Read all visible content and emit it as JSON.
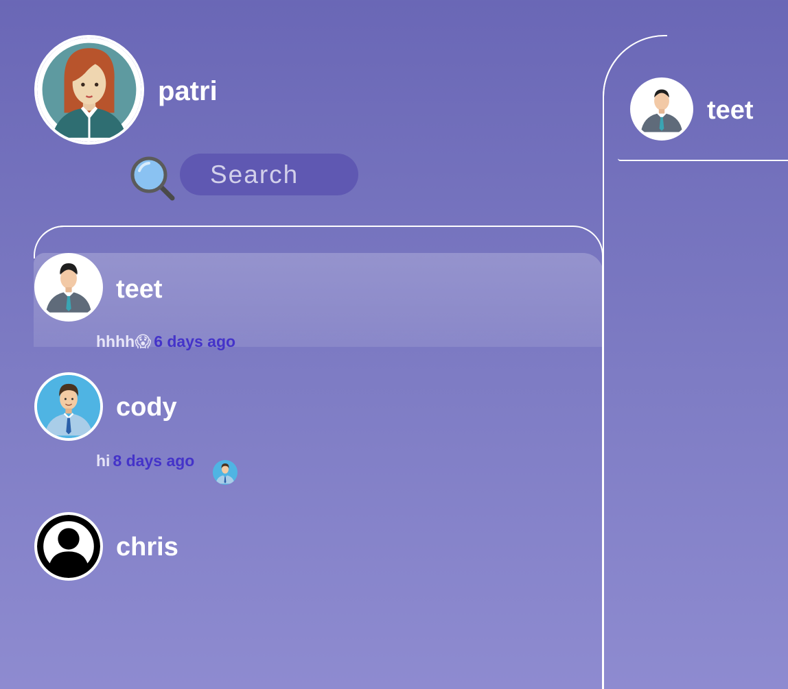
{
  "current_user": {
    "name": "patri",
    "avatar_icon": "woman-avatar-icon"
  },
  "search": {
    "placeholder": "Search",
    "icon": "search-icon"
  },
  "conversations": [
    {
      "name": "teet",
      "avatar_icon": "man-suit-avatar-icon",
      "last_message": "hhhh😱",
      "time": "6 days ago",
      "active": true
    },
    {
      "name": "cody",
      "avatar_icon": "man-blue-avatar-icon",
      "last_message": "hi",
      "time": "8 days ago",
      "seen_by_icon": "man-blue-avatar-icon"
    },
    {
      "name": "chris",
      "avatar_icon": "default-user-avatar-icon"
    }
  ],
  "chat": {
    "contact_name": "teet",
    "avatar_icon": "man-suit-avatar-icon"
  },
  "colors": {
    "background_top": "#6a67b6",
    "background_bottom": "#8e8bd0",
    "search_fill": "#5f58b2",
    "time_text": "#4433c9",
    "text": "#ffffff"
  }
}
